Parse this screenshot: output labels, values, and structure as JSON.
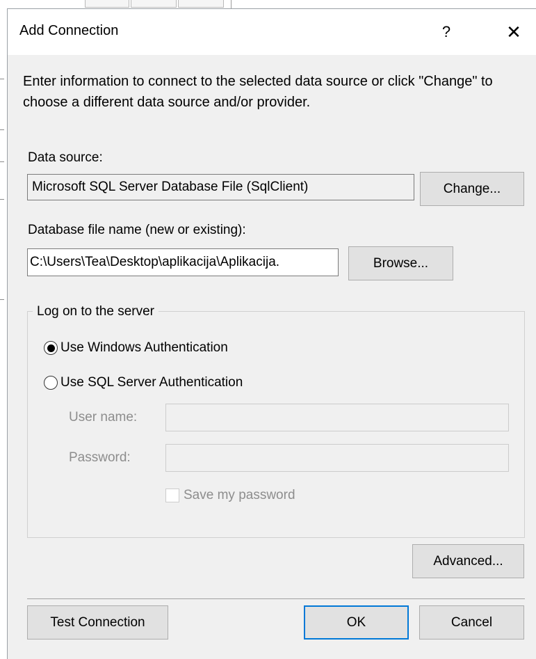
{
  "dialog": {
    "title": "Add Connection",
    "help_glyph": "?",
    "close_glyph": "✕"
  },
  "intro_text": "Enter information to connect to the selected data source or click \"Change\" to choose a different data source and/or provider.",
  "data_source": {
    "label": "Data source:",
    "value": "Microsoft SQL Server Database File (SqlClient)",
    "change_button": "Change..."
  },
  "database_file": {
    "label": "Database file name (new or existing):",
    "value": "C:\\Users\\Tea\\Desktop\\aplikacija\\Aplikacija.",
    "browse_button": "Browse..."
  },
  "logon": {
    "group_title": "Log on to the server",
    "windows_auth_label": "Use Windows Authentication",
    "windows_auth_selected": true,
    "sql_auth_label": "Use SQL Server Authentication",
    "sql_auth_selected": false,
    "username_label": "User name:",
    "username_value": "",
    "password_label": "Password:",
    "password_value": "",
    "save_password_label": "Save my password",
    "save_password_checked": false
  },
  "buttons": {
    "advanced": "Advanced...",
    "test_connection": "Test Connection",
    "ok": "OK",
    "cancel": "Cancel"
  },
  "colors": {
    "dialog_bg": "#f0f0f0",
    "titlebar_bg": "#ffffff",
    "button_bg": "#e1e1e1",
    "default_button_border": "#0078d7",
    "disabled_text": "#8d8d8d"
  }
}
